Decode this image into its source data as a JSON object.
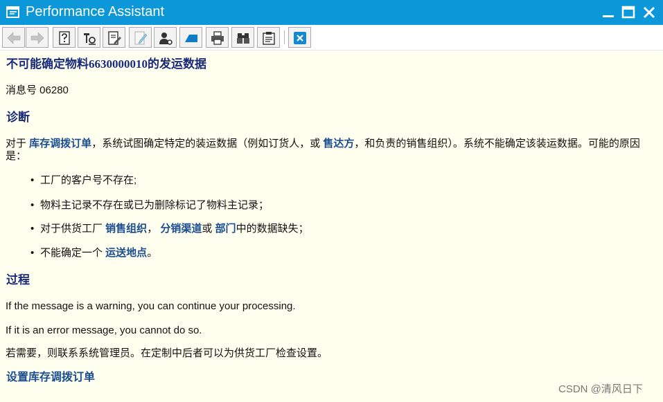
{
  "window": {
    "title": "Performance Assistant"
  },
  "toolbar": {
    "buttons": [
      {
        "icon": "back-arrow-icon"
      },
      {
        "icon": "forward-arrow-icon"
      },
      {
        "icon": "help-document-icon"
      },
      {
        "icon": "technical-info-icon"
      },
      {
        "icon": "edit-document-icon"
      },
      {
        "icon": "pen-icon"
      },
      {
        "icon": "user-settings-icon"
      },
      {
        "icon": "bookmark-icon"
      },
      {
        "icon": "print-icon"
      },
      {
        "icon": "find-binoculars-icon"
      },
      {
        "icon": "document-list-icon"
      },
      {
        "icon": "close-icon"
      }
    ]
  },
  "message": {
    "title": "不可能确定物料6630000010的发运数据",
    "number": "消息号 06280",
    "diagnosis_heading": "诊断",
    "diagnosis_p1_a": "对于 ",
    "diagnosis_link1": "库存调拨订单",
    "diagnosis_p1_b": "，系统试图确定特定的装运数据（例如订货人，或 ",
    "diagnosis_link2": "售达方",
    "diagnosis_p1_c": "，和负责的销售组织）。系统不能确定该装运数据。可能的原因是：",
    "bullet1": "工厂的客户号不存在;",
    "bullet2": "物料主记录不存在或已为删除标记了物料主记录；",
    "bullet3_a": "对于供货工厂 ",
    "bullet3_link1": "销售组织",
    "bullet3_b": "， ",
    "bullet3_link2": "分销渠道",
    "bullet3_c": "或 ",
    "bullet3_link3": "部门",
    "bullet3_d": "中的数据缺失；",
    "bullet4_a": "不能确定一个 ",
    "bullet4_link": "运送地点",
    "bullet4_b": "。",
    "procedure_heading": "过程",
    "procedure_p1": "If the message is a warning, you can continue your processing.",
    "procedure_p2": "If it is an error message, you cannot do so.",
    "procedure_p3": "若需要，则联系系统管理员。在定制中后者可以为供货工厂检查设置。",
    "footer_link": "设置库存调拨订单"
  },
  "watermark": "CSDN @清风日下"
}
